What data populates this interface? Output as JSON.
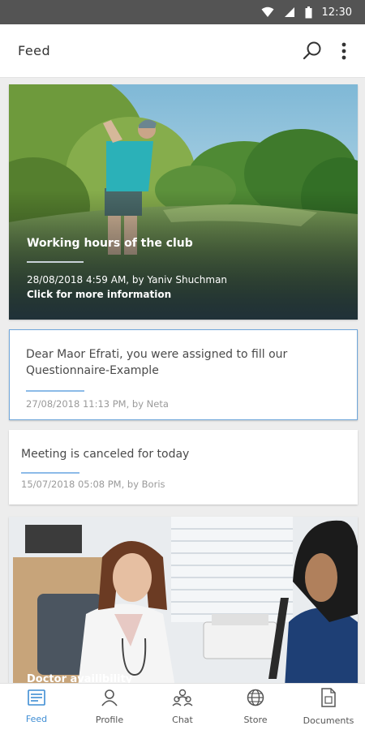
{
  "status_bar": {
    "time": "12:30"
  },
  "app_bar": {
    "title": "Feed",
    "actions": [
      "search-icon",
      "more-vert-icon"
    ]
  },
  "feed": {
    "items": [
      {
        "type": "image",
        "title": "Working hours of the club",
        "meta": "28/08/2018 4:59 AM, by Yaniv Shuchman",
        "link": "Click for more information"
      },
      {
        "type": "text",
        "title": "Dear Maor Efrati, you were assigned to fill our Questionnaire-Example",
        "meta": "27/08/2018 11:13 PM, by Neta",
        "highlighted": true
      },
      {
        "type": "text",
        "title": "Meeting is canceled for today",
        "meta": "15/07/2018 05:08 PM, by Boris"
      },
      {
        "type": "image",
        "title": "Doctor availibility"
      }
    ]
  },
  "bottom_nav": {
    "items": [
      {
        "label": "Feed",
        "icon": "feed-icon",
        "active": true
      },
      {
        "label": "Profile",
        "icon": "profile-icon"
      },
      {
        "label": "Chat",
        "icon": "chat-icon"
      },
      {
        "label": "Store",
        "icon": "globe-icon"
      },
      {
        "label": "Documents",
        "icon": "document-icon"
      }
    ]
  },
  "colors": {
    "accent": "#3f8ed4",
    "highlight_border": "#6fa6da",
    "status_bar": "#545454"
  }
}
